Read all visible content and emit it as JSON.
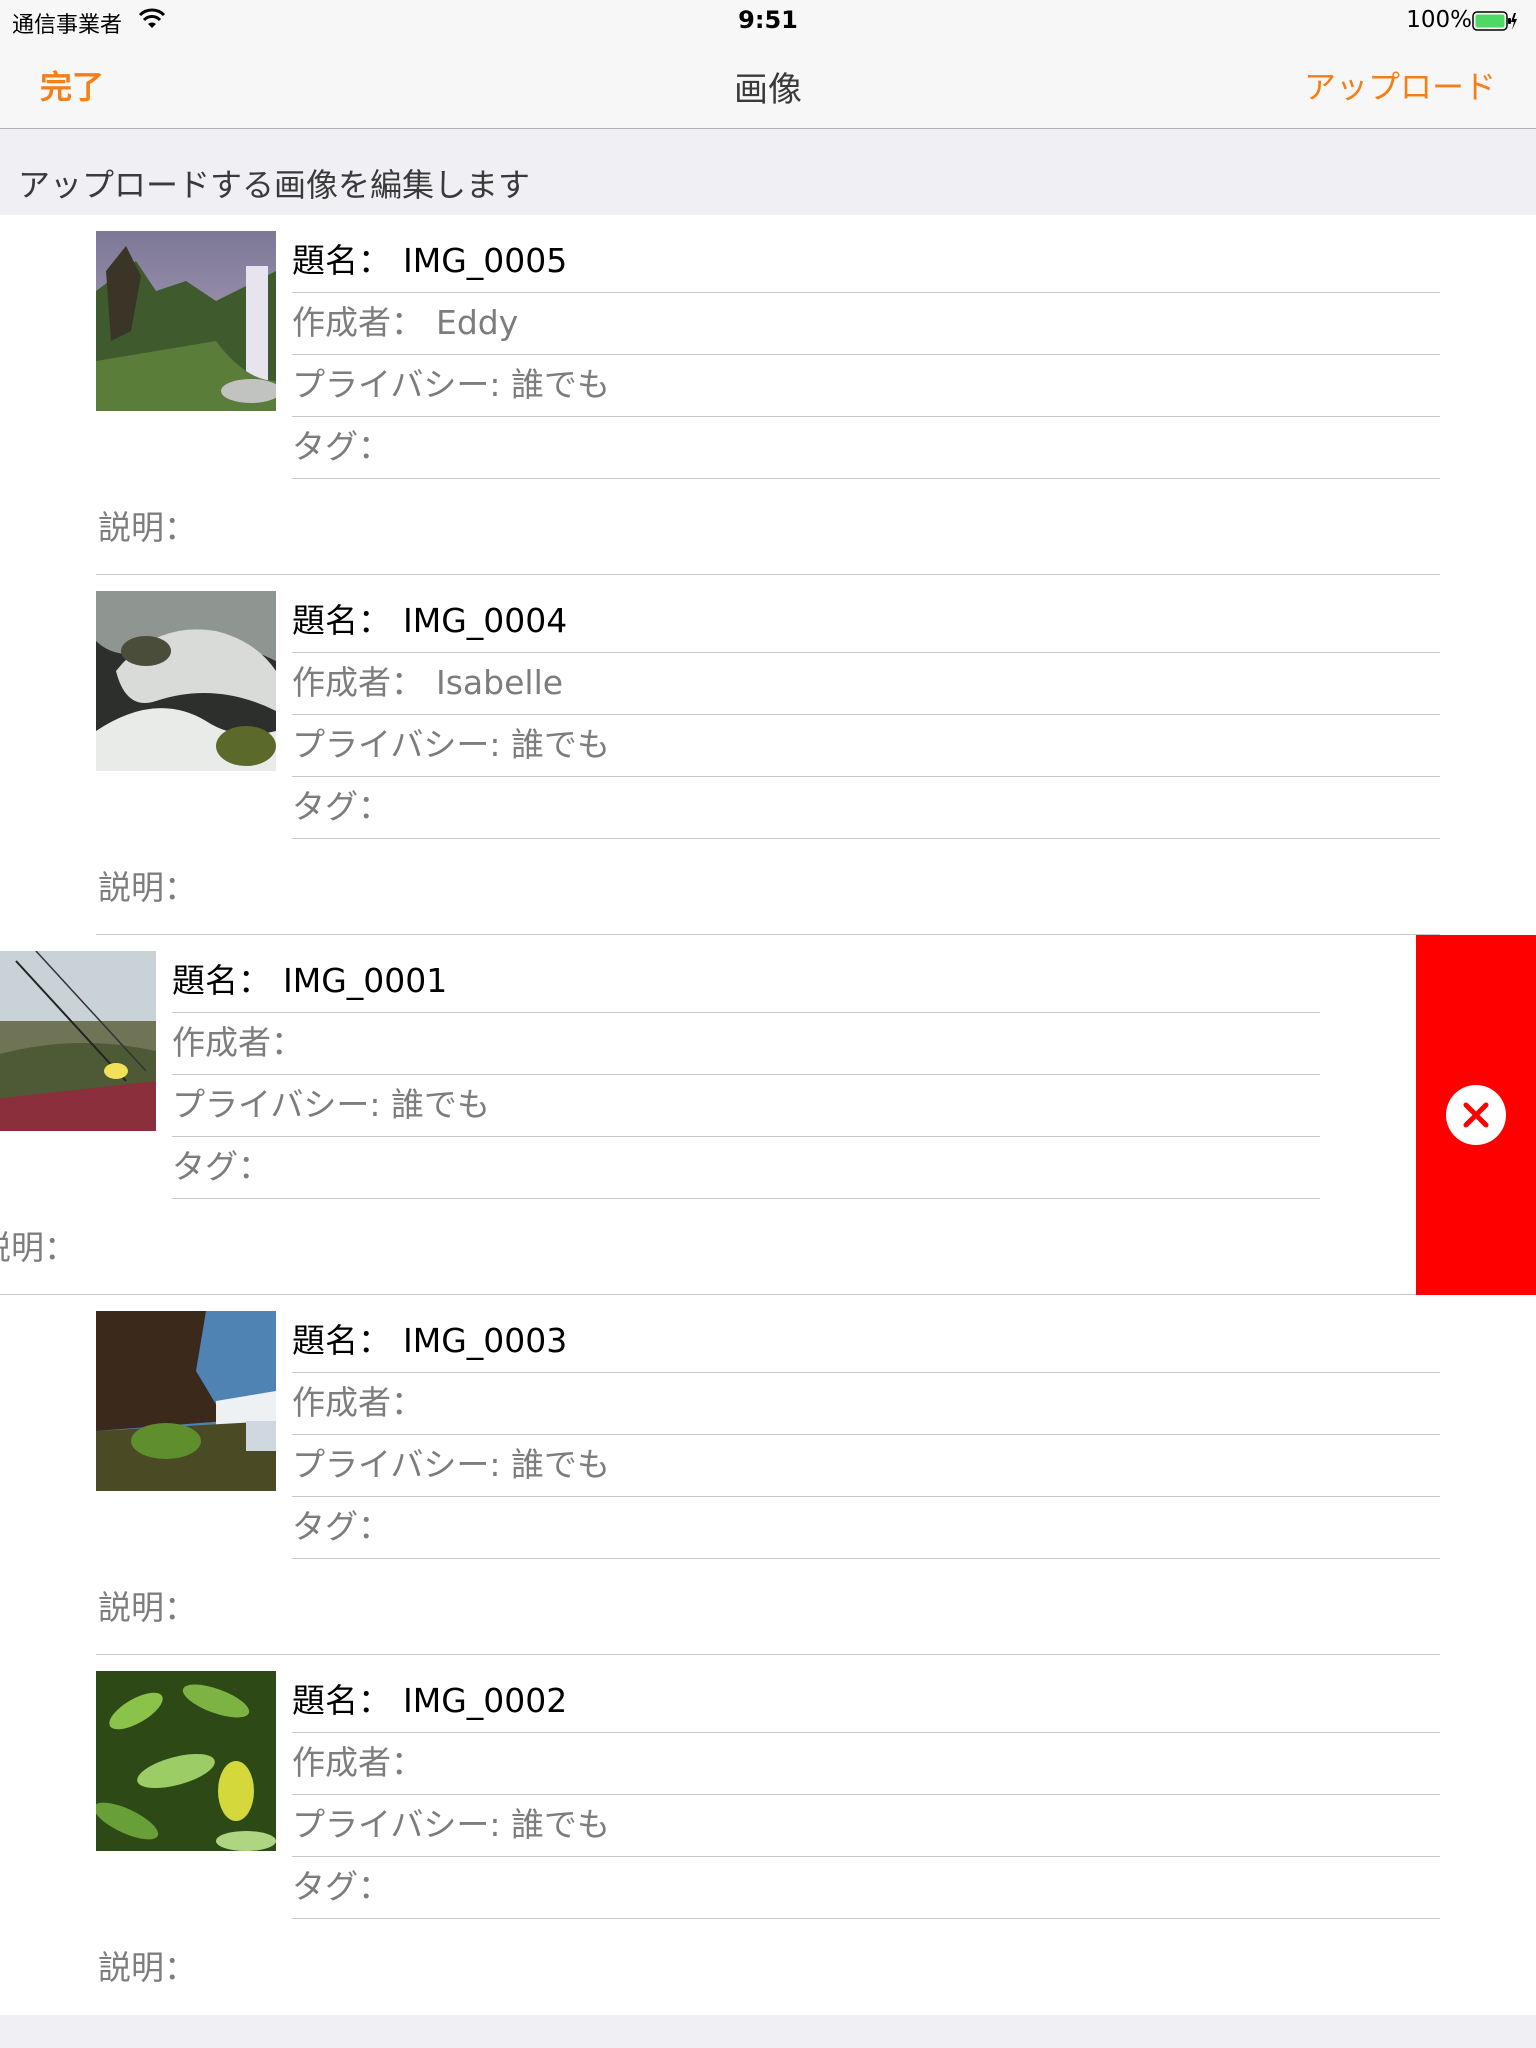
{
  "status_bar": {
    "carrier": "通信事業者",
    "time": "9:51",
    "battery": "100%"
  },
  "nav": {
    "done": "完了",
    "title": "画像",
    "upload": "アップロード"
  },
  "section_header": "アップロードする画像を編集します",
  "colors": {
    "accent": "#f57f17",
    "delete": "#ff0000"
  },
  "images": [
    {
      "title_label": "題名：",
      "title": "IMG_0005",
      "author_label": "作成者：",
      "author": "Eddy",
      "privacy": "プライバシー: 誰でも",
      "tags_label": "タグ：",
      "description_label": "説明："
    },
    {
      "title_label": "題名：",
      "title": "IMG_0004",
      "author_label": "作成者：",
      "author": "Isabelle",
      "privacy": "プライバシー: 誰でも",
      "tags_label": "タグ：",
      "description_label": "説明："
    },
    {
      "title_label": "題名：",
      "title": "IMG_0001",
      "author_label": "作成者：",
      "author": "",
      "privacy": "プライバシー: 誰でも",
      "tags_label": "タグ：",
      "description_label": "説明："
    },
    {
      "title_label": "題名：",
      "title": "IMG_0003",
      "author_label": "作成者：",
      "author": "",
      "privacy": "プライバシー: 誰でも",
      "tags_label": "タグ：",
      "description_label": "説明："
    },
    {
      "title_label": "題名：",
      "title": "IMG_0002",
      "author_label": "作成者：",
      "author": "",
      "privacy": "プライバシー: 誰でも",
      "tags_label": "タグ：",
      "description_label": "説明："
    }
  ],
  "delete_icon": "close-icon"
}
